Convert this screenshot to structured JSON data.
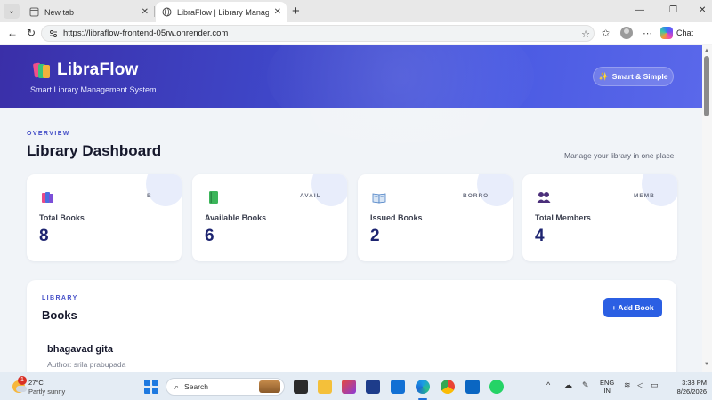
{
  "browser": {
    "tabs": [
      {
        "title": "New tab",
        "active": false
      },
      {
        "title": "LibraFlow | Library Management Sy",
        "active": true
      }
    ],
    "url": "https://libraflow-frontend-05rw.onrender.com",
    "chat_label": "Chat"
  },
  "hero": {
    "brand": "LibraFlow",
    "tagline": "Smart Library Management System",
    "pill_label": "Smart & Simple",
    "pill_icon": "sparkle-icon"
  },
  "overview": {
    "eyebrow": "OVERVIEW",
    "title": "Library Dashboard",
    "subtitle": "Manage your library in one place"
  },
  "stats": [
    {
      "icon": "books-icon",
      "tag": "B",
      "label": "Total Books",
      "value": "8"
    },
    {
      "icon": "green-book-icon",
      "tag": "AVAIL",
      "label": "Available Books",
      "value": "6"
    },
    {
      "icon": "open-book-icon",
      "tag": "BORRO",
      "label": "Issued Books",
      "value": "2"
    },
    {
      "icon": "members-icon",
      "tag": "MEMB",
      "label": "Total Members",
      "value": "4"
    }
  ],
  "books": {
    "eyebrow": "LIBRARY",
    "title": "Books",
    "add_button": "+ Add Book",
    "items": [
      {
        "title": "bhagavad gita",
        "author": "Author: srila prabupada"
      }
    ]
  },
  "taskbar": {
    "weather_temp": "27°C",
    "weather_cond": "Partly sunny",
    "weather_badge": "1",
    "search_placeholder": "Search",
    "lang_line1": "ENG",
    "lang_line2": "IN",
    "time": "3:38 PM",
    "date": "8/26/2026"
  },
  "colors": {
    "hero_start": "#3a2fa8",
    "hero_end": "#5a68ea",
    "accent": "#2b5fe3",
    "value_text": "#1d2470"
  }
}
